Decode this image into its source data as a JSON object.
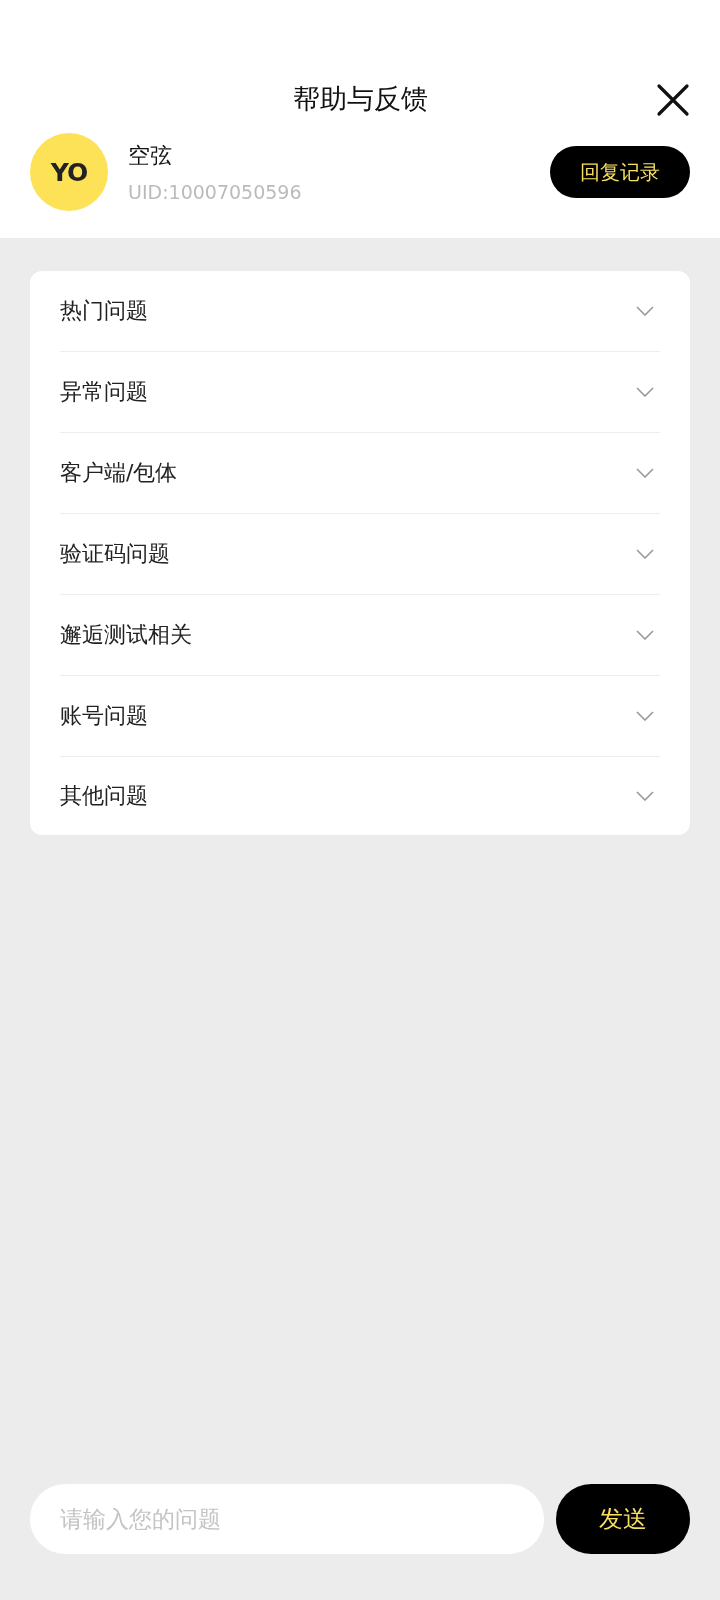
{
  "header": {
    "title": "帮助与反馈"
  },
  "user": {
    "avatar_text": "YO",
    "name": "空弦",
    "uid": "UID:10007050596",
    "history_button": "回复记录"
  },
  "categories": [
    {
      "label": "热门问题",
      "expanded": false
    },
    {
      "label": "异常问题",
      "expanded": false
    },
    {
      "label": "客户端/包体",
      "expanded": false
    },
    {
      "label": "验证码问题",
      "expanded": false
    },
    {
      "label": "邂逅测试相关",
      "expanded": false
    },
    {
      "label": "账号问题",
      "expanded": false
    },
    {
      "label": "其他问题",
      "expanded": false
    }
  ],
  "composer": {
    "placeholder": "请输入您的问题",
    "send_button": "发送"
  }
}
